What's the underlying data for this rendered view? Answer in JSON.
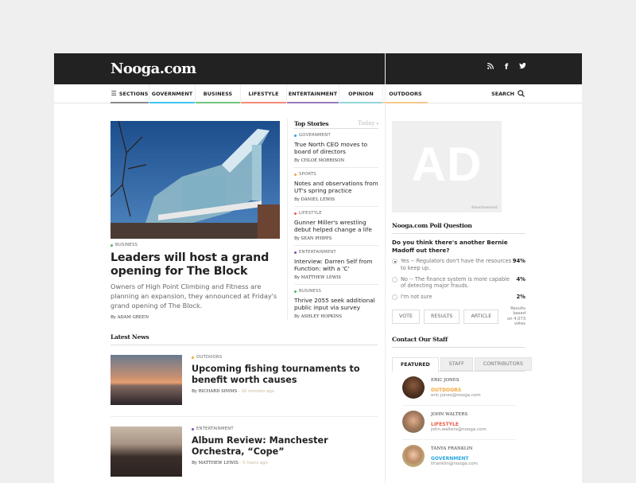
{
  "site": {
    "logo": "Nooga.com"
  },
  "social": [
    {
      "icon": "rss-icon",
      "glyph": "≈"
    },
    {
      "icon": "facebook-icon",
      "glyph": "f"
    },
    {
      "icon": "twitter-icon",
      "glyph": "ὂ6"
    }
  ],
  "nav": {
    "sections_label": "SECTIONS",
    "items": [
      {
        "label": "SECTIONS",
        "color": "#8a8a8a"
      },
      {
        "label": "GOVERNMENT",
        "color": "#3ec3f3"
      },
      {
        "label": "BUSINESS",
        "color": "#73c47b"
      },
      {
        "label": "LIFESTYLE",
        "color": "#f48a74"
      },
      {
        "label": "ENTERTAINMENT",
        "color": "#9b7dc1"
      },
      {
        "label": "OPINION",
        "color": "#93d6d6"
      },
      {
        "label": "OUTDOORS",
        "color": "#f6c98a"
      }
    ],
    "search_label": "SEARCH"
  },
  "hero": {
    "category": "BUSINESS",
    "category_color": "#4cb75a",
    "title": "Leaders will host a grand opening for The Block",
    "summary": "Owners of High Point Climbing and Fitness are planning an expansion, they announced at Friday's grand opening of The Block.",
    "byline": "By ADAM GREEN",
    "image_alt": "The Block climbing gym building"
  },
  "top_stories": {
    "title": "Top Stories",
    "filter": "Today",
    "items": [
      {
        "category": "GOVERNMENT",
        "color": "#2aa6e0",
        "headline": "True North CEO moves to board of directors",
        "byline": "By CHLOÉ MORRISON"
      },
      {
        "category": "SPORTS",
        "color": "#f5a63c",
        "headline": "Notes and observations from UT's spring practice",
        "byline": "By DANIEL LEWIS"
      },
      {
        "category": "LIFESTYLE",
        "color": "#ef5b45",
        "headline": "Gunner Miller's wrestling debut helped change a life",
        "byline": "By SEAN PHIPPS"
      },
      {
        "category": "ENTERTAINMENT",
        "color": "#7e4fb5",
        "headline": "Interview: Darren Self from Function: with a 'C'",
        "byline": "By MATTHEW LEWIS"
      },
      {
        "category": "BUSINESS",
        "color": "#4cb75a",
        "headline": "Thrive 2055 seek additional public input via survey",
        "byline": "By ASHLEY HOPKINS"
      }
    ]
  },
  "ad": {
    "text": "AD",
    "label": "Advertisement"
  },
  "poll": {
    "title": "Nooga.com Poll Question",
    "question": "Do you think there's another Bernie Madoff out there?",
    "options": [
      {
        "text": "Yes -- Regulators don't have the resources to keep up.",
        "percent": "94%",
        "selected": true
      },
      {
        "text": "No -- The finance system is more capable of detecting major frauds.",
        "percent": "4%",
        "selected": false
      },
      {
        "text": "I'm not sure",
        "percent": "2%",
        "selected": false
      }
    ],
    "buttons": [
      "VOTE",
      "RESULTS",
      "ARTICLE"
    ],
    "note_line1": "Results based",
    "note_line2": "on 4,073 votes"
  },
  "staff": {
    "title": "Contact Our Staff",
    "tabs": [
      "FEATURED",
      "STAFF",
      "CONTRIBUTORS"
    ],
    "active_tab": "FEATURED",
    "people": [
      {
        "name": "ERIC JONES",
        "category": "OUTDOORS",
        "color": "#f5a63c",
        "email": "eric.jones@nooga.com"
      },
      {
        "name": "JOHN WALTERS",
        "category": "LIFESTYLE",
        "color": "#ef5b45",
        "email": "john.walters@nooga.com"
      },
      {
        "name": "TANYA FRANKLIN",
        "category": "GOVERNMENT",
        "color": "#2aa6e0",
        "email": "tfranklin@nooga.com"
      }
    ]
  },
  "latest": {
    "title": "Latest News",
    "items": [
      {
        "category": "OUTDOORS",
        "color": "#f5a63c",
        "title": "Upcoming fishing tournaments to benefit worth causes",
        "byline": "By RICHARD SIMMS",
        "time": "16 minutes ago"
      },
      {
        "category": "ENTERTAINMENT",
        "color": "#7e4fb5",
        "title": "Album Review: Manchester Orchestra, “Cope”",
        "byline": "By MATTHEW LEWIS",
        "time": "5 hours ago"
      }
    ]
  }
}
